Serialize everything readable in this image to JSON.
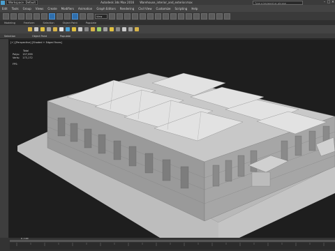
{
  "window": {
    "workspace": "Workspace: Default",
    "app_name": "Autodesk 3ds Max 2016",
    "file_name": "Warehouse_interior_and_exterior.max",
    "search_placeholder": "Type a keyword or phrase"
  },
  "menus": [
    "Edit",
    "Tools",
    "Group",
    "Views",
    "Create",
    "Modifiers",
    "Animation",
    "Graph Editors",
    "Rendering",
    "Civil View",
    "Customize",
    "Scripting",
    "Help"
  ],
  "toolbar": {
    "view_dropdown": "View"
  },
  "ribbon": {
    "tabs": [
      "Modeling",
      "Freeform",
      "Selection",
      "Object Paint",
      "Populate"
    ],
    "lower_labels": [
      "Selection",
      "Object Paint",
      "Populate"
    ]
  },
  "viewport": {
    "label": "[+] [Perspective] [Shaded + Edged Faces]",
    "stats": {
      "total_label": "Total",
      "polys_label": "Polys:",
      "polys_value": "157,999",
      "verts_label": "Verts:",
      "verts_value": "173,172",
      "fps_label": "FPS:"
    }
  },
  "timeline": {
    "frame_counter": "0 / 100"
  },
  "colors": {
    "accent": "#2f6fad",
    "viewport_bg": "#1e1e1e"
  }
}
